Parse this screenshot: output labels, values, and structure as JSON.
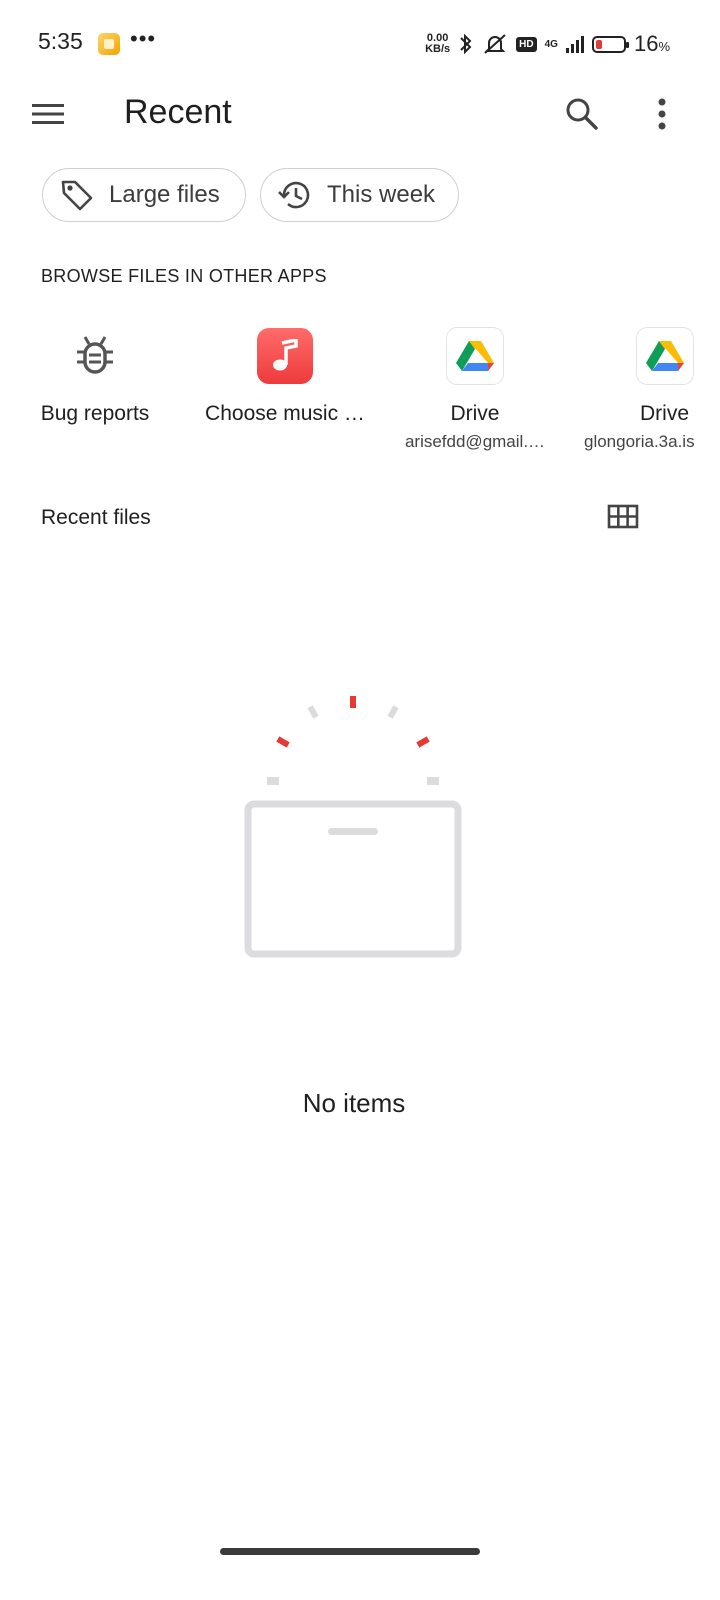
{
  "status_bar": {
    "time": "5:35",
    "more": "•••",
    "net_speed_value": "0.00",
    "net_speed_unit": "KB/s",
    "hd": "HD",
    "network": "4G",
    "battery_percent": "16",
    "battery_unit": "%",
    "battery_level": 0.16
  },
  "app_bar": {
    "title": "Recent"
  },
  "chips": [
    {
      "label": "Large files",
      "icon": "tag-icon"
    },
    {
      "label": "This week",
      "icon": "history-icon"
    }
  ],
  "browse_section": {
    "title": "BROWSE FILES IN OTHER APPS",
    "apps": [
      {
        "label": "Bug reports",
        "subtitle": "",
        "icon": "bug-icon"
      },
      {
        "label": "Choose music …",
        "subtitle": "",
        "icon": "music-note-icon"
      },
      {
        "label": "Drive",
        "subtitle": "arisefdd@gmail.…",
        "icon": "google-drive-icon"
      },
      {
        "label": "Drive",
        "subtitle": "glongoria.3a.is",
        "icon": "google-drive-icon"
      }
    ]
  },
  "recent_files": {
    "title": "Recent files",
    "view_toggle_icon": "grid-view-icon",
    "empty_text": "No items"
  },
  "colors": {
    "accent_red": "#e53935",
    "chip_border": "#cfcfcf",
    "illustration_gray": "#dcdcde"
  }
}
